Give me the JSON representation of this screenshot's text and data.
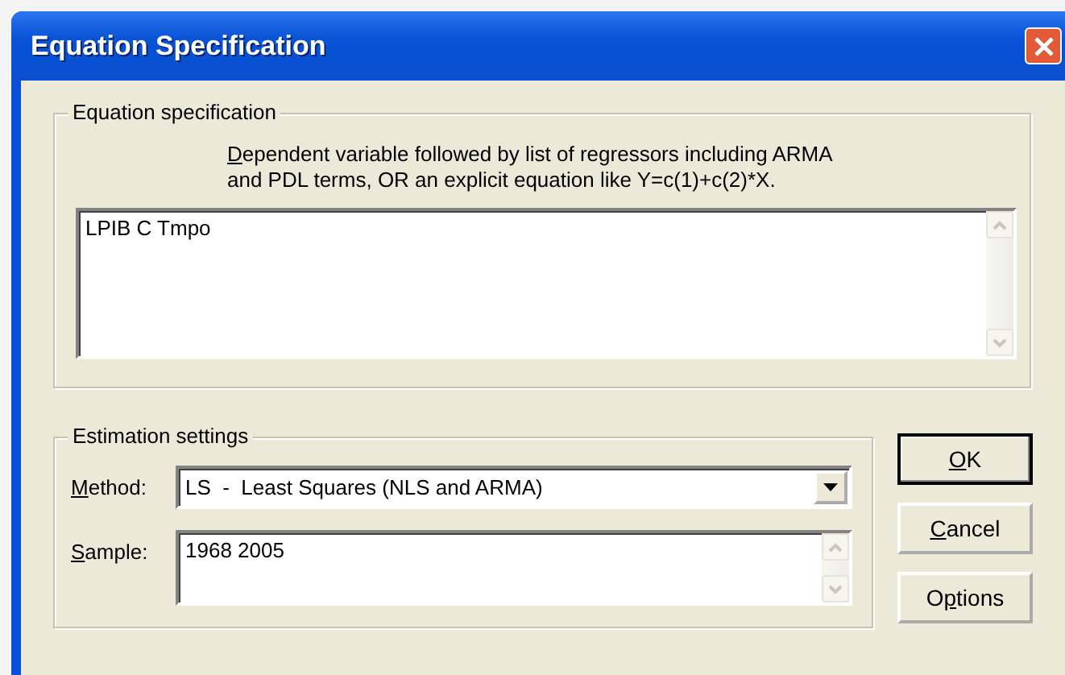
{
  "window": {
    "title": "Equation Specification"
  },
  "equation_group": {
    "title": "Equation specification",
    "hint_lines": [
      {
        "parts": [
          {
            "text": "D",
            "underlined": true
          },
          {
            "text": "ependent variable followed by list of regressors including ARMA",
            "underlined": false
          }
        ]
      },
      {
        "parts": [
          {
            "text": "and PDL terms, OR an explicit equation like Y=c(1)+c(2)*X.",
            "underlined": false
          }
        ]
      }
    ],
    "equation": {
      "value": "LPIB C Tmpo"
    }
  },
  "estimation_group": {
    "title": "Estimation settings",
    "method": {
      "label_parts": [
        {
          "text": "M",
          "underlined": true
        },
        {
          "text": "ethod:",
          "underlined": false
        }
      ],
      "value": "LS  -  Least Squares (NLS and ARMA)"
    },
    "sample": {
      "label_parts": [
        {
          "text": "S",
          "underlined": true
        },
        {
          "text": "ample:",
          "underlined": false
        }
      ],
      "value": "1968 2005"
    }
  },
  "buttons": [
    {
      "parts": [
        {
          "text": "O",
          "underlined": true
        },
        {
          "text": "K",
          "underlined": false
        }
      ],
      "default": true
    },
    {
      "parts": [
        {
          "text": "C",
          "underlined": true
        },
        {
          "text": "ancel",
          "underlined": false
        }
      ],
      "default": false
    },
    {
      "parts": [
        {
          "text": "O",
          "underlined": false
        },
        {
          "text": "p",
          "underlined": true
        },
        {
          "text": "tions",
          "underlined": false
        }
      ],
      "default": false
    }
  ]
}
